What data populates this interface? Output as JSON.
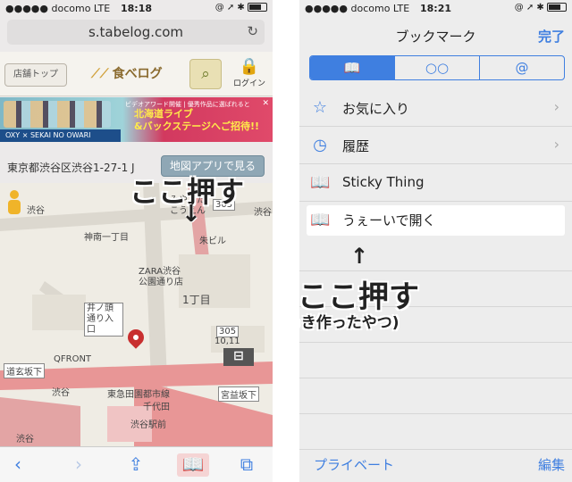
{
  "left": {
    "status": {
      "carrier": "●●●●● docomo  LTE",
      "time": "18:18",
      "icons": "@ ➚ ✱"
    },
    "url": "s.tabelog.com",
    "site": {
      "store_top": "店舗トップ",
      "logo": "食べログ",
      "login": "ログイン"
    },
    "banner": {
      "small": "ビデオアワード開催 | 優秀作品に選ばれると",
      "big_line1": "北海道ライブ",
      "big_line2": "&バックステージへご招待!!",
      "strip": "OXY × SEKAI NO OWARI"
    },
    "address": "東京都渋谷区渋谷1-27-1  J",
    "map_button": "地図アプリで見る",
    "map_labels": {
      "shibuya_top": "渋谷",
      "jinnan": "神南一丁目",
      "miyashita": "みやした こうえん",
      "shibuya_right": "渋谷",
      "shuka": "朱ビル",
      "zara": "ZARA渋谷 公園通り店",
      "itchome": "1丁目",
      "inokashira": "井ノ頭 通り入口",
      "qfront": "QFRONT",
      "dogenzaka": "道玄坂下",
      "shibuya_station": "渋谷",
      "toyoko": "東急田園都市線",
      "miyamasu": "宮益坂下",
      "chiyoda": "千代田",
      "shibuya_ekimae": "渋谷駅前",
      "shibuya_bottom": "渋谷",
      "route305": "305",
      "route305b": "305",
      "num_10_11": "10,11"
    },
    "annotation": "ここ押す",
    "annotation_arrow": "↓"
  },
  "right": {
    "status": {
      "carrier": "●●●●● docomo  LTE",
      "time": "18:21",
      "icons": "@ ➚ ✱"
    },
    "title": "ブックマーク",
    "done": "完了",
    "segments": [
      {
        "label": "📖",
        "active": true
      },
      {
        "label": "○○",
        "active": false
      },
      {
        "label": "@",
        "active": false
      }
    ],
    "bookmarks": [
      {
        "icon": "☆",
        "label": "お気に入り",
        "chevron": "›"
      },
      {
        "icon": "◷",
        "label": "履歴",
        "chevron": "›"
      },
      {
        "icon": "📖",
        "label": "Sticky Thing",
        "chevron": ""
      },
      {
        "icon": "📖",
        "label": "うぇーいで開く",
        "chevron": ""
      }
    ],
    "annotation_arrow": "↑",
    "annotation1": "ここ押す",
    "annotation2": "(さっき作ったやつ)",
    "private": "プライベート",
    "edit": "編集"
  },
  "colors": {
    "accent": "#3f7fe0",
    "map_road": "#e89696",
    "map_bg": "#efece4",
    "pin": "#c82f2f"
  },
  "icons": {
    "reload": "reload-icon",
    "search": "search-icon",
    "lock": "lock-icon",
    "back": "back-icon",
    "forward": "forward-icon",
    "share": "share-icon",
    "bookmarks": "bookmarks-icon",
    "tabs": "tabs-icon"
  }
}
